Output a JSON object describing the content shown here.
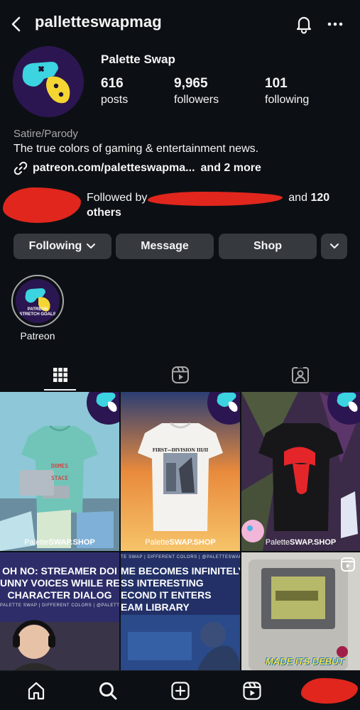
{
  "header": {
    "username": "palletteswapmag"
  },
  "profile": {
    "display_name": "Palette Swap",
    "stats": [
      {
        "value": "616",
        "label": "posts"
      },
      {
        "value": "9,965",
        "label": "followers"
      },
      {
        "value": "101",
        "label": "following"
      }
    ],
    "category": "Satire/Parody",
    "bio": "The true colors of gaming & entertainment news.",
    "link": "patreon.com/paletteswapma...",
    "link_more": "and 2 more",
    "followed_by_prefix": "Followed by",
    "followed_by_suffix_1": "and",
    "followed_by_count": "120",
    "followed_by_suffix_2": "others"
  },
  "actions": {
    "following": "Following",
    "message": "Message",
    "shop": "Shop"
  },
  "highlights": [
    {
      "label": "Patreon",
      "cover_text_1": "PATREON",
      "cover_text_2": "STRETCH GOALS"
    }
  ],
  "grid": {
    "shop_label_light": "Palette",
    "shop_label_bold": "SWAP.SHOP",
    "shirt1_text_1": "DOMES",
    "shirt1_text_2": "STACE",
    "shirt2_text": "FIRST—DIVISION III/II",
    "post4_headline": [
      "OH NO: STREAMER DOI",
      "UNNY VOICES WHILE READI",
      "CHARACTER DIALOG"
    ],
    "post4_sub": "PALETTE SWAP | DIFFERENT COLORS | @PALETTESWAPMAG",
    "post5_headline": [
      "ME BECOMES INFINITELY",
      "SS INTERESTING",
      "ECOND IT ENTERS",
      "EAM LIBRARY"
    ],
    "post5_sub": "TE SWAP | DIFFERENT COLORS | @PALETTESWAPMAG",
    "post6_caption": "MADE ITS DEBUT"
  },
  "colors": {
    "background": "#0c1014",
    "button": "#363a3f",
    "redaction": "#e0261d",
    "brand_purple": "#2c1651",
    "brand_cyan": "#3bd4e0",
    "brand_yellow": "#f4d532"
  }
}
